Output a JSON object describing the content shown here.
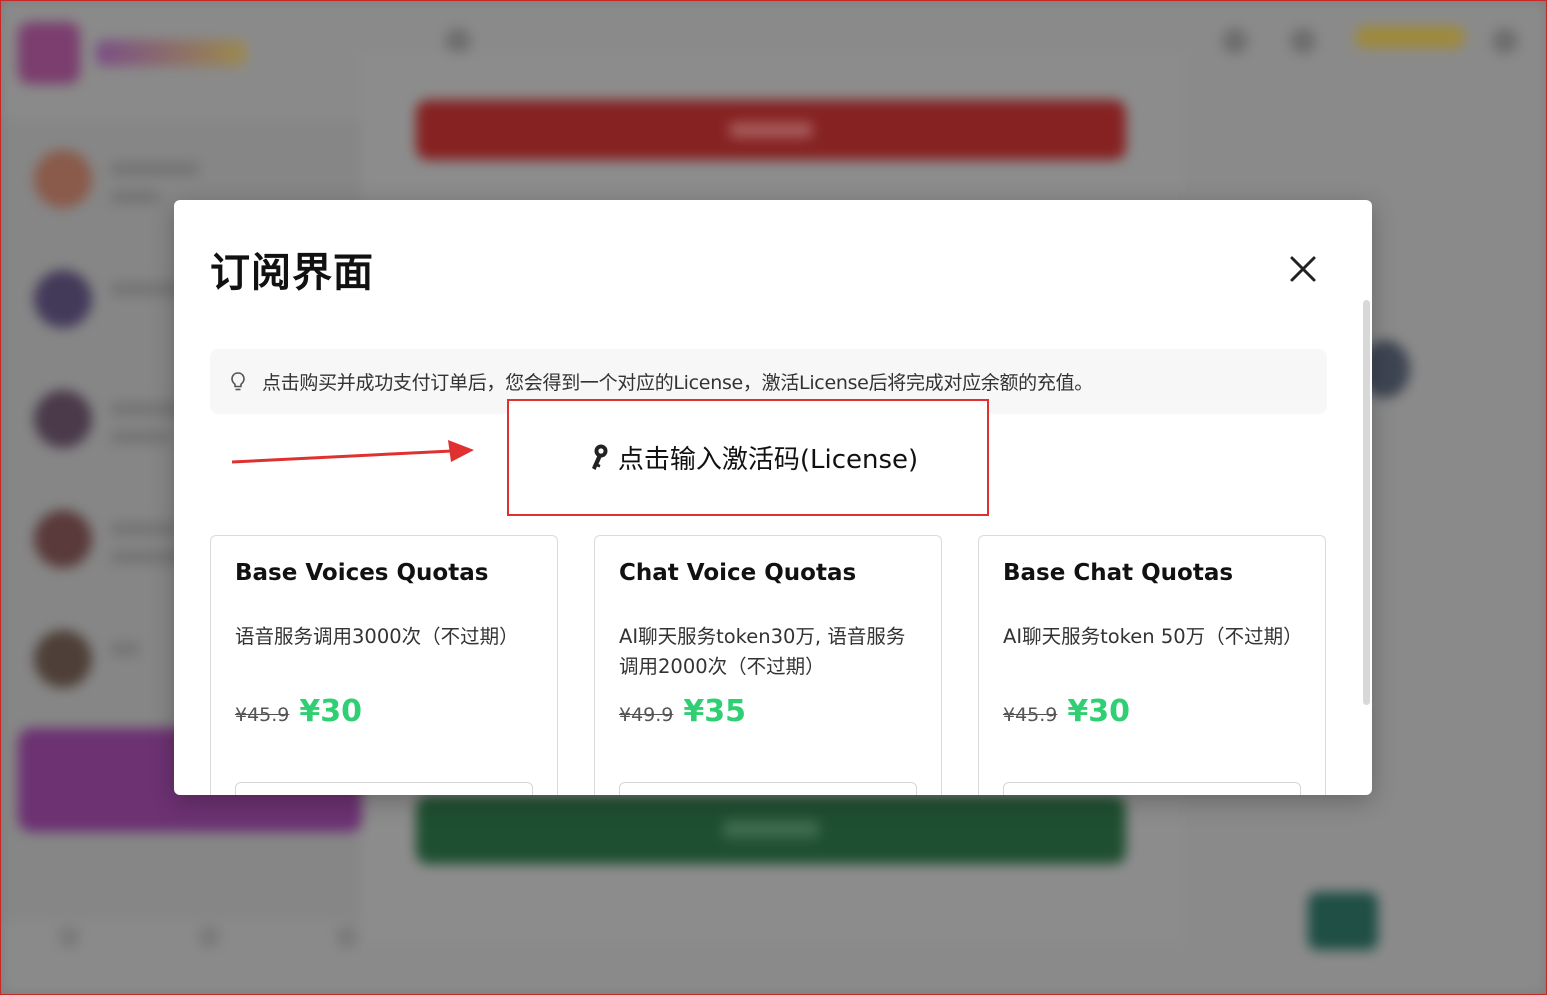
{
  "modal": {
    "title": "订阅界面",
    "tip_text": "点击购买并成功支付订单后，您会得到一个对应的License，激活License后将完成对应余额的充值。",
    "license_button_label": "点击输入激活码(License)"
  },
  "plans": [
    {
      "title": "Base Voices Quotas",
      "description": "语音服务调用3000次（不过期）",
      "original_price": "¥45.9",
      "price": "¥30"
    },
    {
      "title": "Chat Voice Quotas",
      "description": "AI聊天服务token30万, 语音服务调用2000次（不过期）",
      "original_price": "¥49.9",
      "price": "¥35"
    },
    {
      "title": "Base Chat Quotas",
      "description": "AI聊天服务token 50万（不过期）",
      "original_price": "¥45.9",
      "price": "¥30"
    }
  ],
  "colors": {
    "price_green": "#2fcf74",
    "annotation_red": "#e03131",
    "backdrop_red_button": "#862222",
    "backdrop_green_button": "#1f4f31"
  },
  "icons": {
    "close": "close-icon",
    "tip": "lightbulb-icon",
    "license": "key-icon",
    "annotation": "red-arrow-icon"
  }
}
